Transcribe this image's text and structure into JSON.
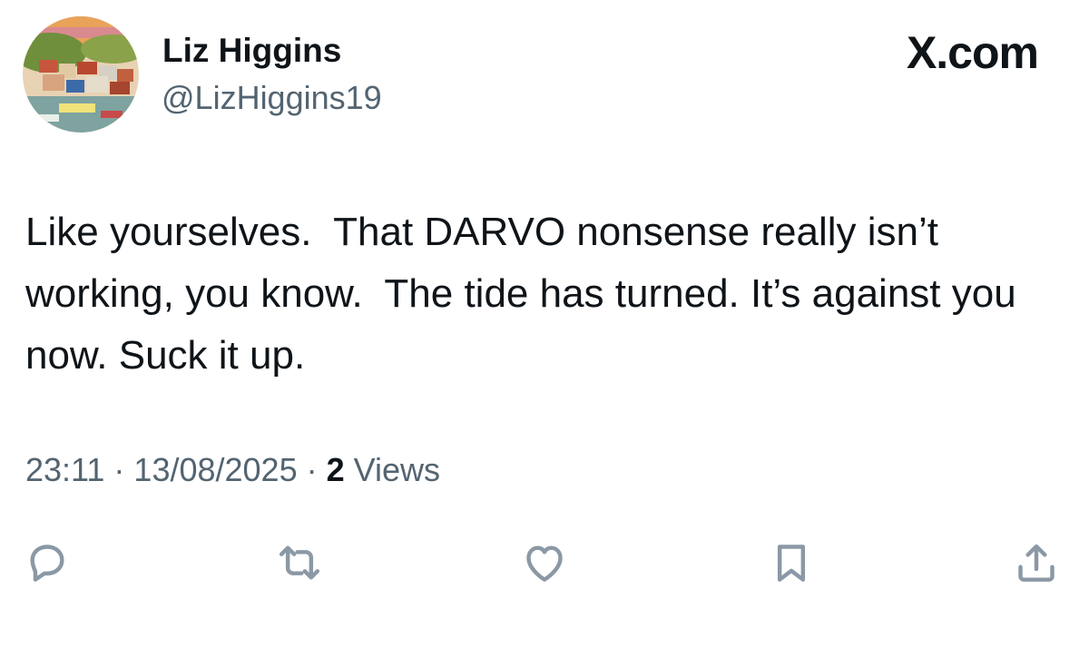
{
  "user": {
    "display_name": "Liz Higgins",
    "handle": "@LizHiggins19",
    "avatar_icon": "avatar-harbour-village-photo"
  },
  "brand": {
    "label": "X.com"
  },
  "tweet": {
    "text": "Like yourselves.  That DARVO nonsense really isn’t working, you know.  The tide has turned. It’s against you now. Suck it up.",
    "time": "23:11",
    "date": "13/08/2025",
    "separator": " · ",
    "views_count": "2",
    "views_label": " Views"
  },
  "actions": [
    {
      "name": "reply",
      "icon": "reply-icon"
    },
    {
      "name": "retweet",
      "icon": "retweet-icon"
    },
    {
      "name": "like",
      "icon": "heart-icon"
    },
    {
      "name": "bookmark",
      "icon": "bookmark-icon"
    },
    {
      "name": "share",
      "icon": "share-icon"
    }
  ],
  "colors": {
    "text_primary": "#0f1419",
    "text_secondary": "#536471",
    "icon": "#8b98a5"
  }
}
